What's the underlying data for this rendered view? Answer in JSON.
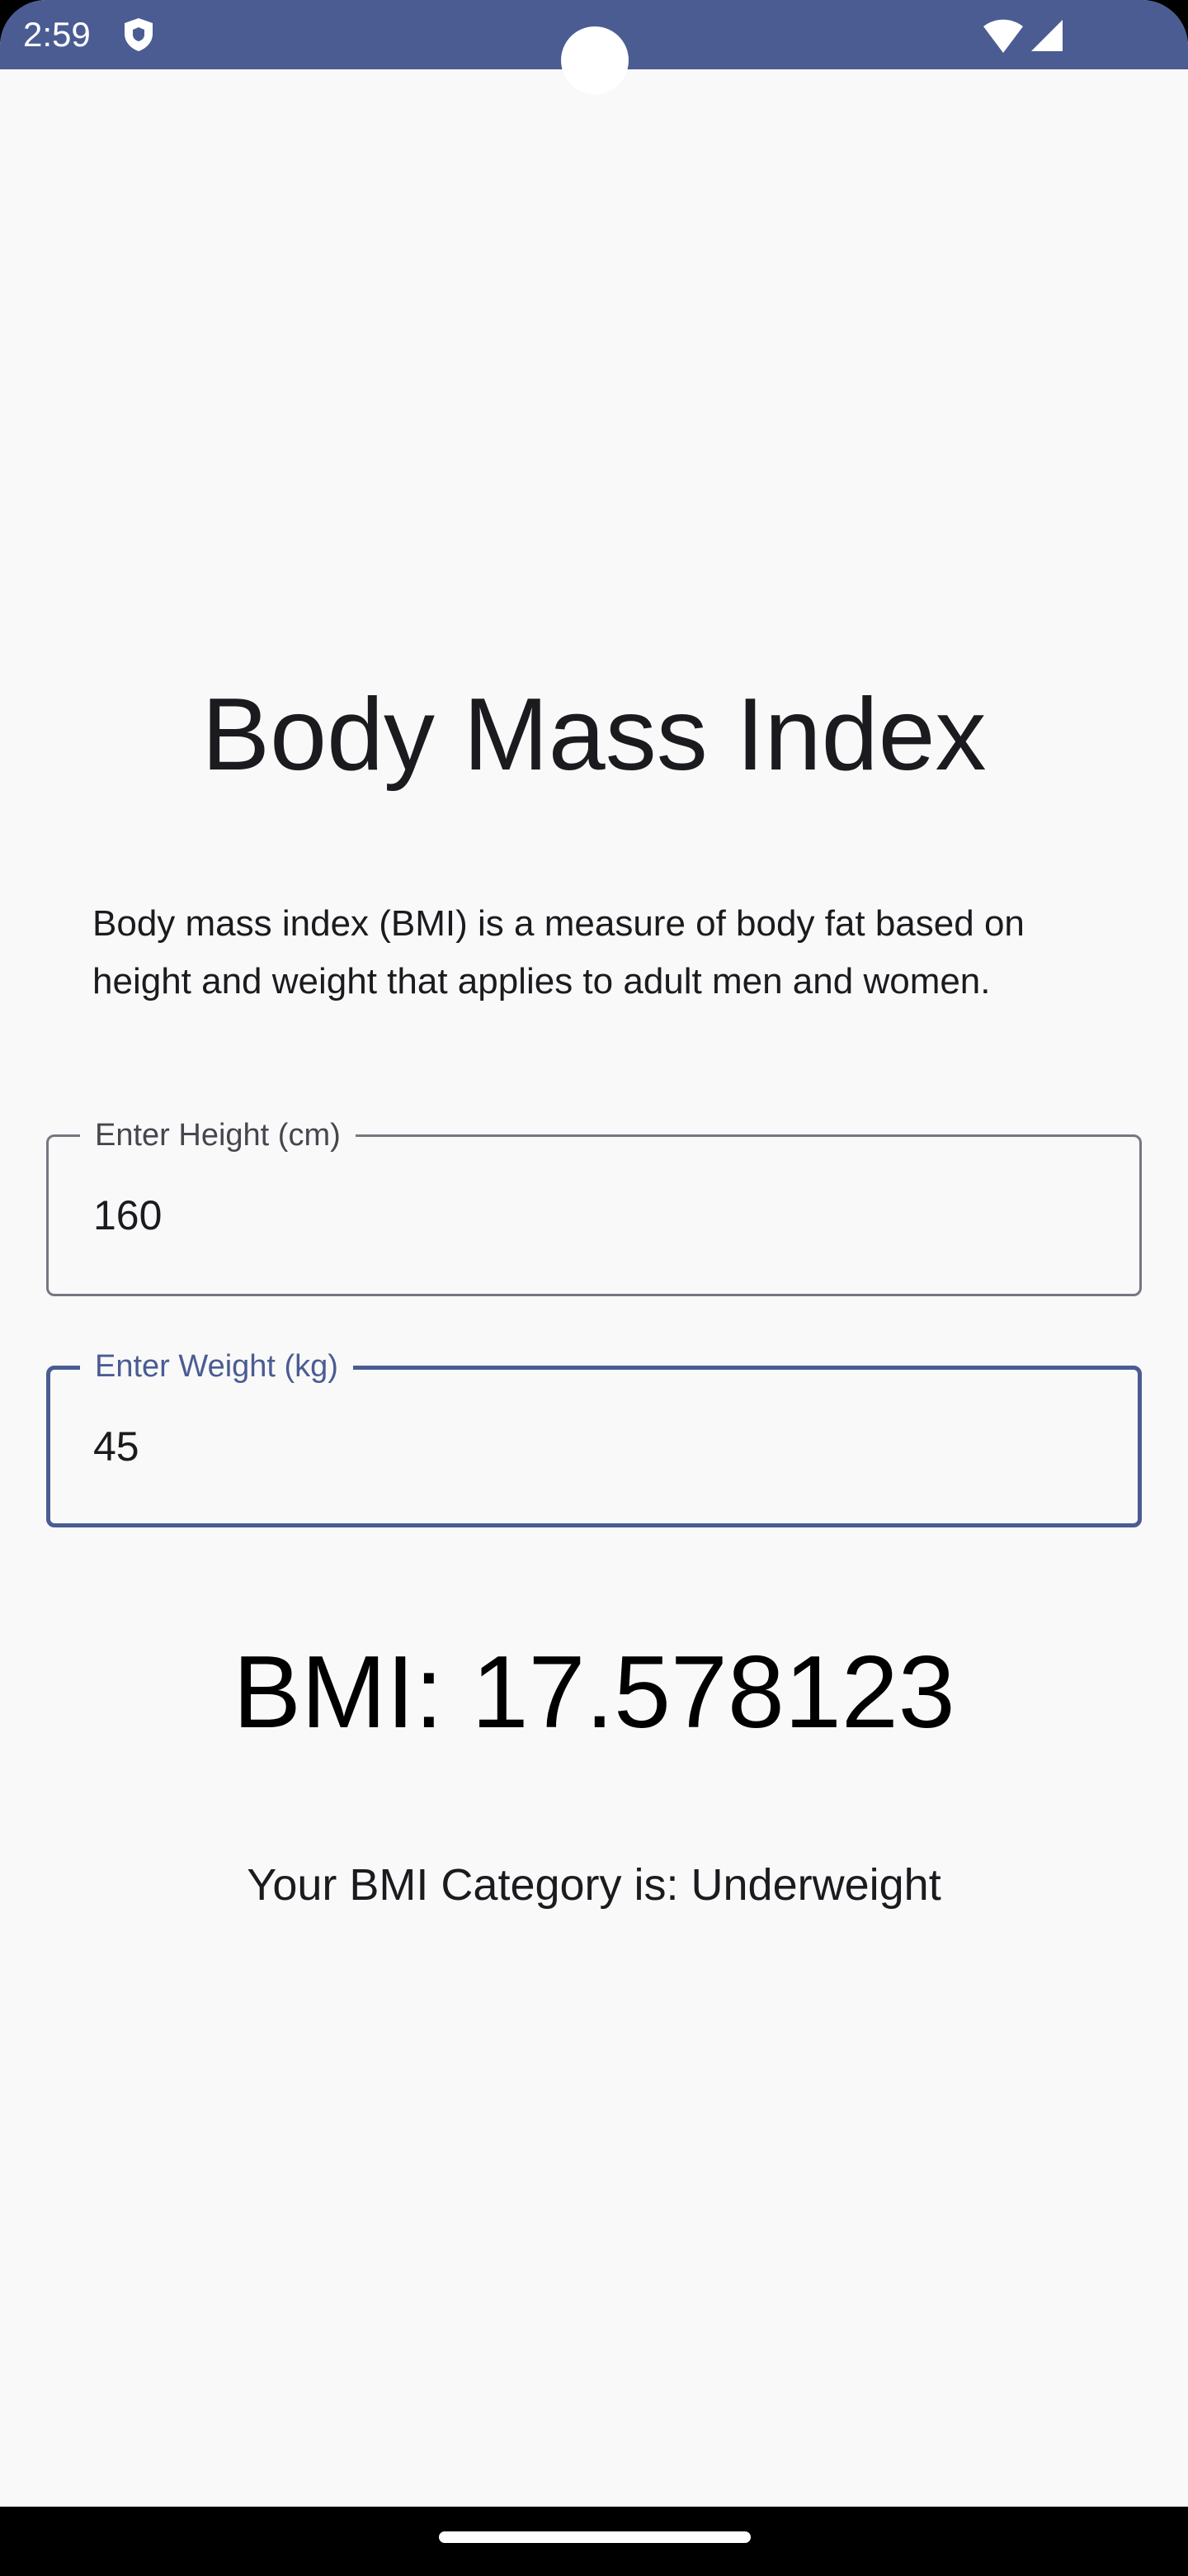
{
  "status_bar": {
    "time": "2:59",
    "background_color": "#4a5c92",
    "icons": [
      "shield-icon",
      "wifi-icon",
      "cellular-signal-icon"
    ]
  },
  "main": {
    "title": "Body Mass Index",
    "description": "Body mass index (BMI) is a measure of body fat based on height and weight that applies to adult men and women.",
    "height_field": {
      "label": "Enter Height (cm)",
      "value": "160"
    },
    "weight_field": {
      "label": "Enter Weight (kg)",
      "value": "45",
      "focused": true
    },
    "bmi_result": "BMI: 17.578123",
    "bmi_category": "Your BMI Category is: Underweight"
  },
  "colors": {
    "accent": "#4a5c92",
    "background": "#f9f9f9",
    "outline": "#777680"
  }
}
